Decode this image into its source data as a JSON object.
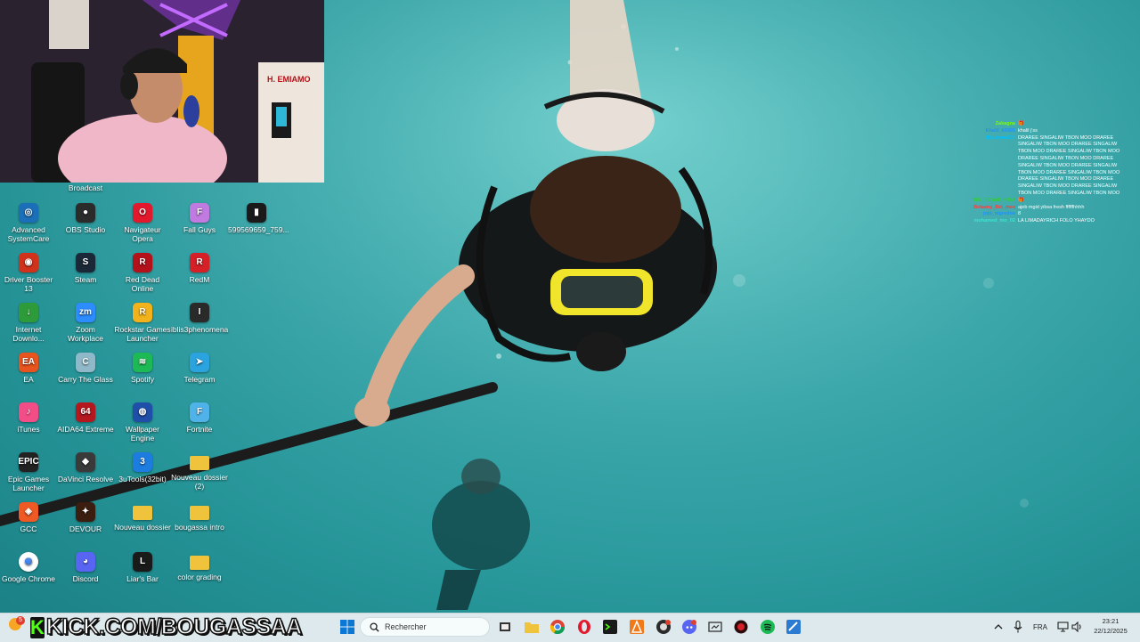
{
  "webcam": {
    "label": "Broadcast",
    "poster_text": "H. EMIAMO"
  },
  "desktop": {
    "icons": [
      {
        "label": "Advanced SystemCare",
        "icon": "advanced-systemcare-icon",
        "color": "#1b6fb8",
        "glyph": "◎"
      },
      {
        "label": "OBS Studio",
        "icon": "obs-studio-icon",
        "color": "#2b2b2b",
        "glyph": "●"
      },
      {
        "label": "Navigateur Opera",
        "icon": "opera-icon",
        "color": "#e2192c",
        "glyph": "O"
      },
      {
        "label": "Fall Guys",
        "icon": "fall-guys-icon",
        "color": "#c07ae0",
        "glyph": "F"
      },
      {
        "label": "599569659_759...",
        "icon": "video-file-icon",
        "color": "#1a1a1a",
        "glyph": "▮"
      },
      {
        "label": "Driver Booster 13",
        "icon": "driver-booster-icon",
        "color": "#d0321b",
        "glyph": "◉"
      },
      {
        "label": "Steam",
        "icon": "steam-icon",
        "color": "#1b2838",
        "glyph": "S"
      },
      {
        "label": "Red Dead Online",
        "icon": "red-dead-online-icon",
        "color": "#b3121a",
        "glyph": "R"
      },
      {
        "label": "RedM",
        "icon": "redm-icon",
        "color": "#d62027",
        "glyph": "R"
      },
      {
        "label": "Internet Downlo...",
        "icon": "internet-download-manager-icon",
        "color": "#2e9b3a",
        "glyph": "↓"
      },
      {
        "label": "Zoom Workplace",
        "icon": "zoom-icon",
        "color": "#2d8cff",
        "glyph": "zm"
      },
      {
        "label": "Rockstar Games Launcher",
        "icon": "rockstar-icon",
        "color": "#f2b21c",
        "glyph": "R"
      },
      {
        "label": "iblis3phenomena",
        "icon": "iblis-icon",
        "color": "#2a2a2a",
        "glyph": "I"
      },
      {
        "label": "EA",
        "icon": "ea-icon",
        "color": "#e8541d",
        "glyph": "EA"
      },
      {
        "label": "Carry The Glass",
        "icon": "carry-the-glass-icon",
        "color": "#8fb9c9",
        "glyph": "C"
      },
      {
        "label": "Spotify",
        "icon": "spotify-icon",
        "color": "#1db954",
        "glyph": "≋"
      },
      {
        "label": "Telegram",
        "icon": "telegram-icon",
        "color": "#2aa3df",
        "glyph": "➤"
      },
      {
        "label": "iTunes",
        "icon": "itunes-icon",
        "color": "#f24d86",
        "glyph": "♪"
      },
      {
        "label": "AIDA64 Extreme",
        "icon": "aida64-icon",
        "color": "#b4171e",
        "glyph": "64"
      },
      {
        "label": "Wallpaper Engine",
        "icon": "wallpaper-engine-icon",
        "color": "#1f4fa8",
        "glyph": "◍"
      },
      {
        "label": "Fortnite",
        "icon": "fortnite-icon",
        "color": "#4fb3ea",
        "glyph": "F"
      },
      {
        "label": "Epic Games Launcher",
        "icon": "epic-games-icon",
        "color": "#222222",
        "glyph": "EPIC"
      },
      {
        "label": "DaVinci Resolve",
        "icon": "davinci-resolve-icon",
        "color": "#3a3a3a",
        "glyph": "◆"
      },
      {
        "label": "3uTools(32bit)",
        "icon": "3utools-icon",
        "color": "#1d7ce0",
        "glyph": "3"
      },
      {
        "label": "Nouveau dossier (2)",
        "icon": "folder-icon",
        "color": "#f0c33c",
        "glyph": ""
      },
      {
        "label": "GCC",
        "icon": "gcc-icon",
        "color": "#ef5a24",
        "glyph": "◈"
      },
      {
        "label": "DEVOUR",
        "icon": "devour-icon",
        "color": "#3b1e10",
        "glyph": "✦"
      },
      {
        "label": "Nouveau dossier",
        "icon": "folder-icon",
        "color": "#f0c33c",
        "glyph": ""
      },
      {
        "label": "bougassa intro",
        "icon": "folder-icon",
        "color": "#f0c33c",
        "glyph": ""
      },
      {
        "label": "Google Chrome",
        "icon": "chrome-icon",
        "color": "#ffffff",
        "glyph": "◉"
      },
      {
        "label": "Discord",
        "icon": "discord-icon",
        "color": "#5865f2",
        "glyph": "◕"
      },
      {
        "label": "Liar's Bar",
        "icon": "liars-bar-icon",
        "color": "#1a1a1a",
        "glyph": "L"
      },
      {
        "label": "color grading",
        "icon": "folder-icon",
        "color": "#f0c33c",
        "glyph": ""
      }
    ]
  },
  "chat": {
    "messages": [
      {
        "user": "Zakagna",
        "user_color": "#7CFC00",
        "text": "🎁"
      },
      {
        "user": "Khalil_k0301",
        "user_color": "#1e90ff",
        "text": "khalil j'ss"
      },
      {
        "user": "Ratanam720",
        "user_color": "#00bfff",
        "text": "DRAREE SINGALIW TBON MOO DRAREE SINGALIW TBON MOO DRAREE SINGALIW TBON MOO DRAREE SINGALIW TBON MOO DRAREE SINGALIW TBON MOO DRAREE SINGALIW TBON MOO DRAREE SINGALIW TBON MOO DRAREE SINGALIW TBON MOO DRAREE SINGALIW TBON MOO DRAREE SINGALIW TBON MOO DRAREE SINGALIW TBON MOO DRAREE SINGALIW TBON MOO"
      },
      {
        "user": "BG_REVAD_NIRA",
        "user_color": "#32cd32",
        "text": "🎁"
      },
      {
        "user": "Belaeny_Bel_mes",
        "user_color": "#ff3b3b",
        "text": "ajeb mgid yibsa fresh ffffffhhhh"
      },
      {
        "user": "jojo_nigredos",
        "user_color": "#1e90ff",
        "text": "8"
      },
      {
        "user": "mohamed_mo_02",
        "user_color": "#40e0d0",
        "text": "LA LIMADAYRICH FOLO YHAYDO"
      }
    ]
  },
  "taskbar": {
    "brand_k": "K",
    "brand_text": "KICK.COM/BOUGASSAA",
    "weather_badge": "5",
    "search_placeholder": "Rechercher",
    "language": "FRA",
    "time": "23:21",
    "date": "22/12/2025"
  },
  "colors": {
    "taskbar_bg": "#dde9ec",
    "kick_green": "#53fc18"
  }
}
